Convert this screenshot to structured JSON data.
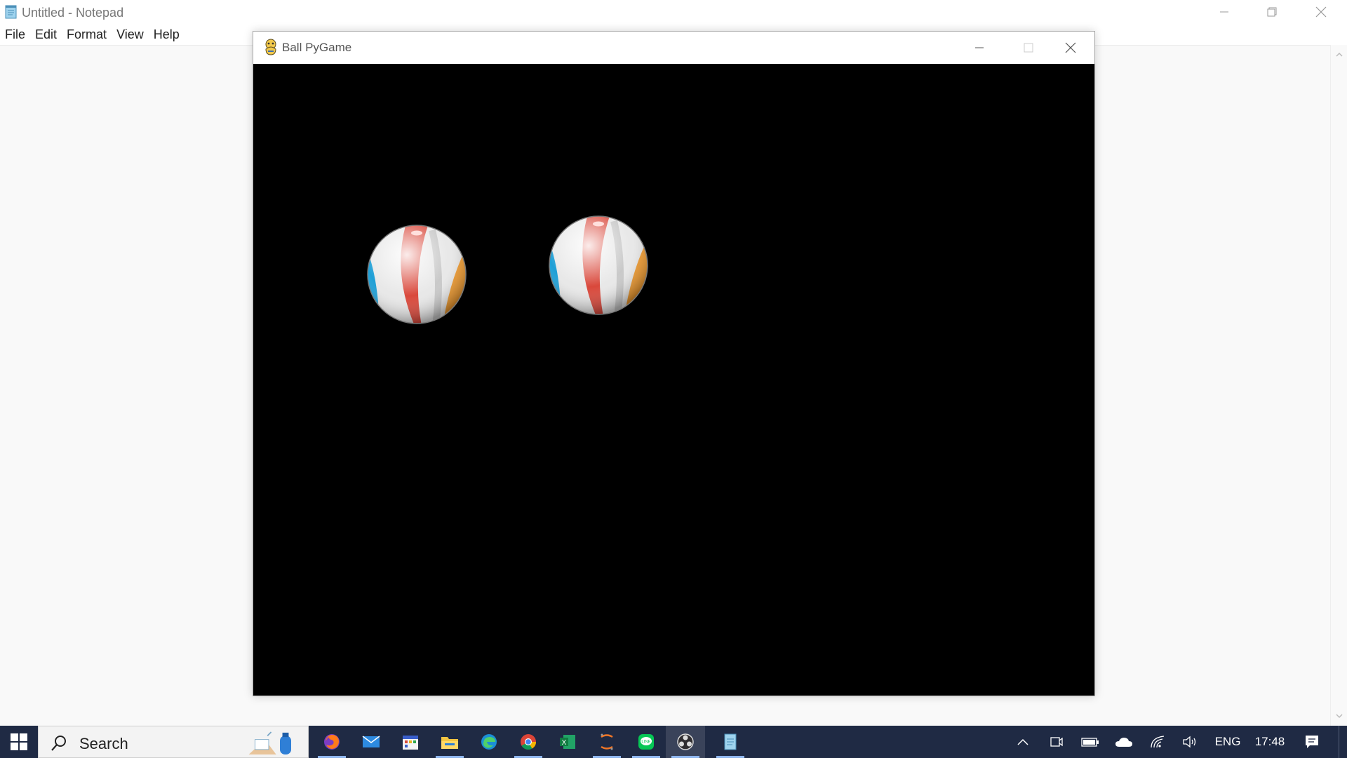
{
  "notepad": {
    "title": "Untitled - Notepad",
    "menu": [
      "File",
      "Edit",
      "Format",
      "View",
      "Help"
    ],
    "icon": "notepad-icon"
  },
  "pygame_window": {
    "title": "Ball PyGame",
    "icon": "pygame-snake-icon",
    "canvas_color": "#000000",
    "sprites": [
      "beach-ball",
      "beach-ball"
    ]
  },
  "taskbar": {
    "search_placeholder": "Search",
    "apps": [
      "firefox-icon",
      "mail-icon",
      "calendar-icon",
      "file-explorer-icon",
      "edge-icon",
      "chrome-icon",
      "excel-icon",
      "code-editor-icon",
      "line-icon",
      "obs-icon",
      "notepad-icon"
    ],
    "language": "ENG",
    "time": "17:48"
  },
  "colors": {
    "taskbar_bg": "#1f2a44",
    "ball_red": "#d9483b",
    "ball_blue": "#1e9fd6",
    "ball_orange": "#f09a2e"
  }
}
